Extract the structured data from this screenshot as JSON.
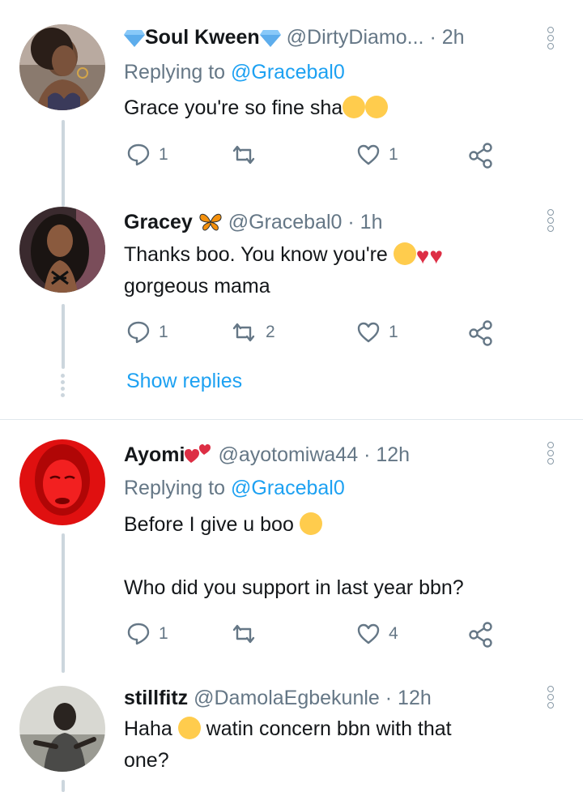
{
  "tweets": [
    {
      "name": "Soul Kween",
      "name_prefix_icon": "blue-diamond-emoji",
      "name_suffix_icon": "blue-diamond-emoji",
      "handle": "@DirtyDiamo...",
      "time": "2h",
      "replying_label": "Replying to",
      "replying_to": "@Gracebal0",
      "text": "Grace you're so fine sha",
      "text_emojis": [
        "laughing-tears-emoji",
        "kissing-heart-emoji"
      ],
      "replies": "1",
      "retweets": "",
      "likes": "1"
    },
    {
      "name": "Gracey",
      "name_suffix_icon": "butterfly-emoji",
      "handle": "@Gracebal0",
      "time": "1h",
      "text_line1": "Thanks boo.  You know you're",
      "text_line2": "gorgeous mama",
      "text_emojis": [
        "smirk-emoji",
        "red-heart-emoji",
        "red-heart-emoji"
      ],
      "replies": "1",
      "retweets": "2",
      "likes": "1",
      "show_replies": "Show replies"
    },
    {
      "name": "Ayomi",
      "name_suffix_icon": "two-hearts-emoji",
      "handle": "@ayotomiwa44",
      "time": "12h",
      "replying_label": "Replying to",
      "replying_to": "@Gracebal0",
      "text_line1": "Before I give u boo",
      "text_line2": "Who did you support in last year bbn?",
      "text_emojis": [
        "eye-roll-emoji"
      ],
      "replies": "1",
      "retweets": "",
      "likes": "4"
    },
    {
      "name": "stillfitz",
      "handle": "@DamolaEgbekunle",
      "time": "12h",
      "text_pre": "Haha",
      "text_post": "watin concern bbn with that",
      "text_line2": "one?",
      "text_emojis": [
        "laughing-tears-emoji"
      ]
    }
  ],
  "separator": "·",
  "colors": {
    "accent": "#1da1f2",
    "secondary_text": "#657786",
    "thread_line": "#ccd6dd",
    "heart_emoji": "#dd2e44"
  }
}
